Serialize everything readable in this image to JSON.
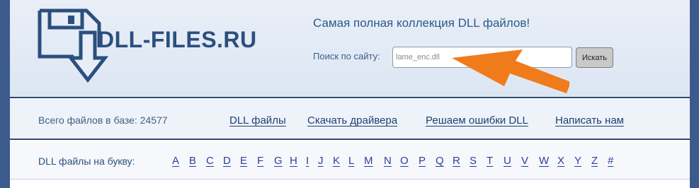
{
  "header": {
    "logo_text": "DLL-FILES.RU",
    "tagline": "Самая полная коллекция DLL файлов!",
    "search": {
      "label": "Поиск по сайту:",
      "placeholder": "lame_enc.dll",
      "button_label": "Искать"
    }
  },
  "nav": {
    "total_files": "Всего файлов в базе: 24577",
    "links": [
      "DLL файлы",
      "Скачать драйвера",
      "Решаем ошибки DLL",
      "Написать нам"
    ]
  },
  "letters": {
    "label": "DLL файлы на букву:",
    "items": [
      "A",
      "B",
      "C",
      "D",
      "E",
      "F",
      "G",
      "H",
      "I",
      "J",
      "K",
      "L",
      "M",
      "N",
      "O",
      "P",
      "Q",
      "R",
      "S",
      "T",
      "U",
      "V",
      "W",
      "X",
      "Y",
      "Z",
      "#"
    ]
  },
  "colors": {
    "brand": "#2b4f7e",
    "link": "#1f3f73",
    "arrow": "#f07b1a",
    "page_bg": "#3c5a8c"
  },
  "icons": {
    "logo": "floppy-disk-download-icon",
    "annotation": "orange-arrow-icon"
  }
}
